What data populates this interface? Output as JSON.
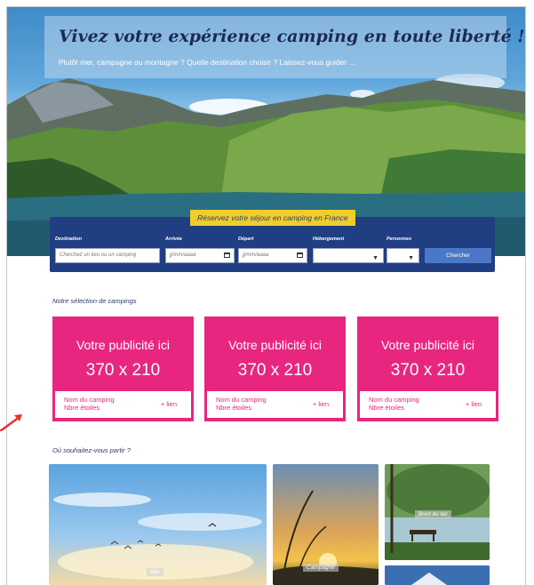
{
  "hero": {
    "title": "Vivez votre expérience camping en toute liberté !",
    "subtitle": "Plutôt mer, campagne ou montagne ? Quelle destination choisir ? Laissez-vous guider ..."
  },
  "search": {
    "heading": "Réservez votre séjour en camping en France",
    "destination_label": "Destination",
    "destination_placeholder": "Cherchez un lieu ou un camping",
    "arrival_label": "Arrivée",
    "arrival_placeholder": "jj/mm/aaaa",
    "departure_label": "Départ",
    "departure_placeholder": "jj/mm/aaaa",
    "accommodation_label": "Hébergement",
    "persons_label": "Personnes",
    "search_button": "Chercher"
  },
  "selection": {
    "title": "Notre sélection de campings",
    "cards": [
      {
        "line1": "Votre publicité ici",
        "line2": "370 x 210",
        "name": "Nom du camping",
        "stars": "Nbre étoiles",
        "link": "+ lien"
      },
      {
        "line1": "Votre publicité ici",
        "line2": "370 x 210",
        "name": "Nom du camping",
        "stars": "Nbre étoiles",
        "link": "+ lien"
      },
      {
        "line1": "Votre publicité ici",
        "line2": "370 x 210",
        "name": "Nom du camping",
        "stars": "Nbre étoiles",
        "link": "+ lien"
      }
    ]
  },
  "destinations": {
    "title": "Où souhaitez-vous partir ?",
    "items": [
      {
        "label": "Mer"
      },
      {
        "label": "Campagne"
      },
      {
        "label": "Bord du lac"
      }
    ]
  },
  "colors": {
    "accent_pink": "#e8267f",
    "search_blue": "#1f3f82",
    "heading_yellow": "#f2cd2a",
    "button_blue": "#4b78c6"
  }
}
